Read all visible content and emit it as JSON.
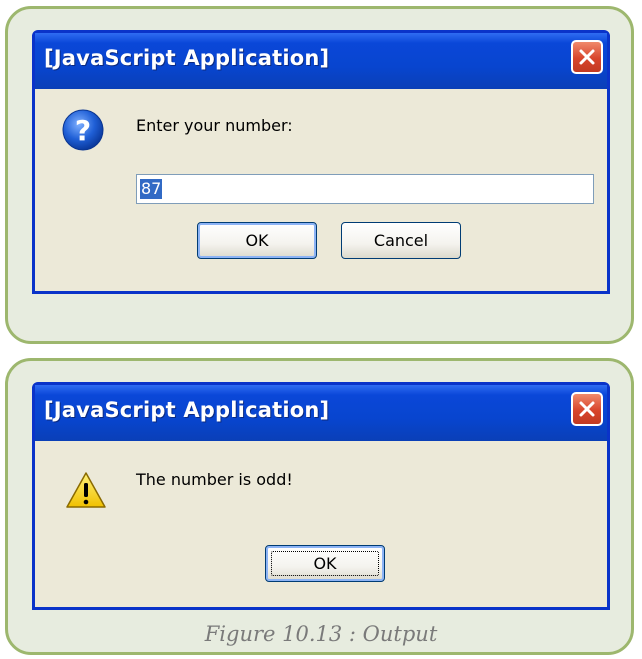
{
  "prompt_dialog": {
    "title": "[JavaScript Application]",
    "message": "Enter your number:",
    "input_value": "87",
    "ok_label": "OK",
    "cancel_label": "Cancel",
    "icon": "question-icon"
  },
  "alert_dialog": {
    "title": "[JavaScript Application]",
    "message": "The number is odd!",
    "ok_label": "OK",
    "icon": "warning-icon"
  },
  "caption": "Figure 10.13 :  Output",
  "colors": {
    "panel_border": "#9db76e",
    "panel_fill": "#e7ecdf",
    "titlebar": "#0a47d8",
    "dialog_body": "#ece9d8",
    "close_button": "#d8452c"
  }
}
